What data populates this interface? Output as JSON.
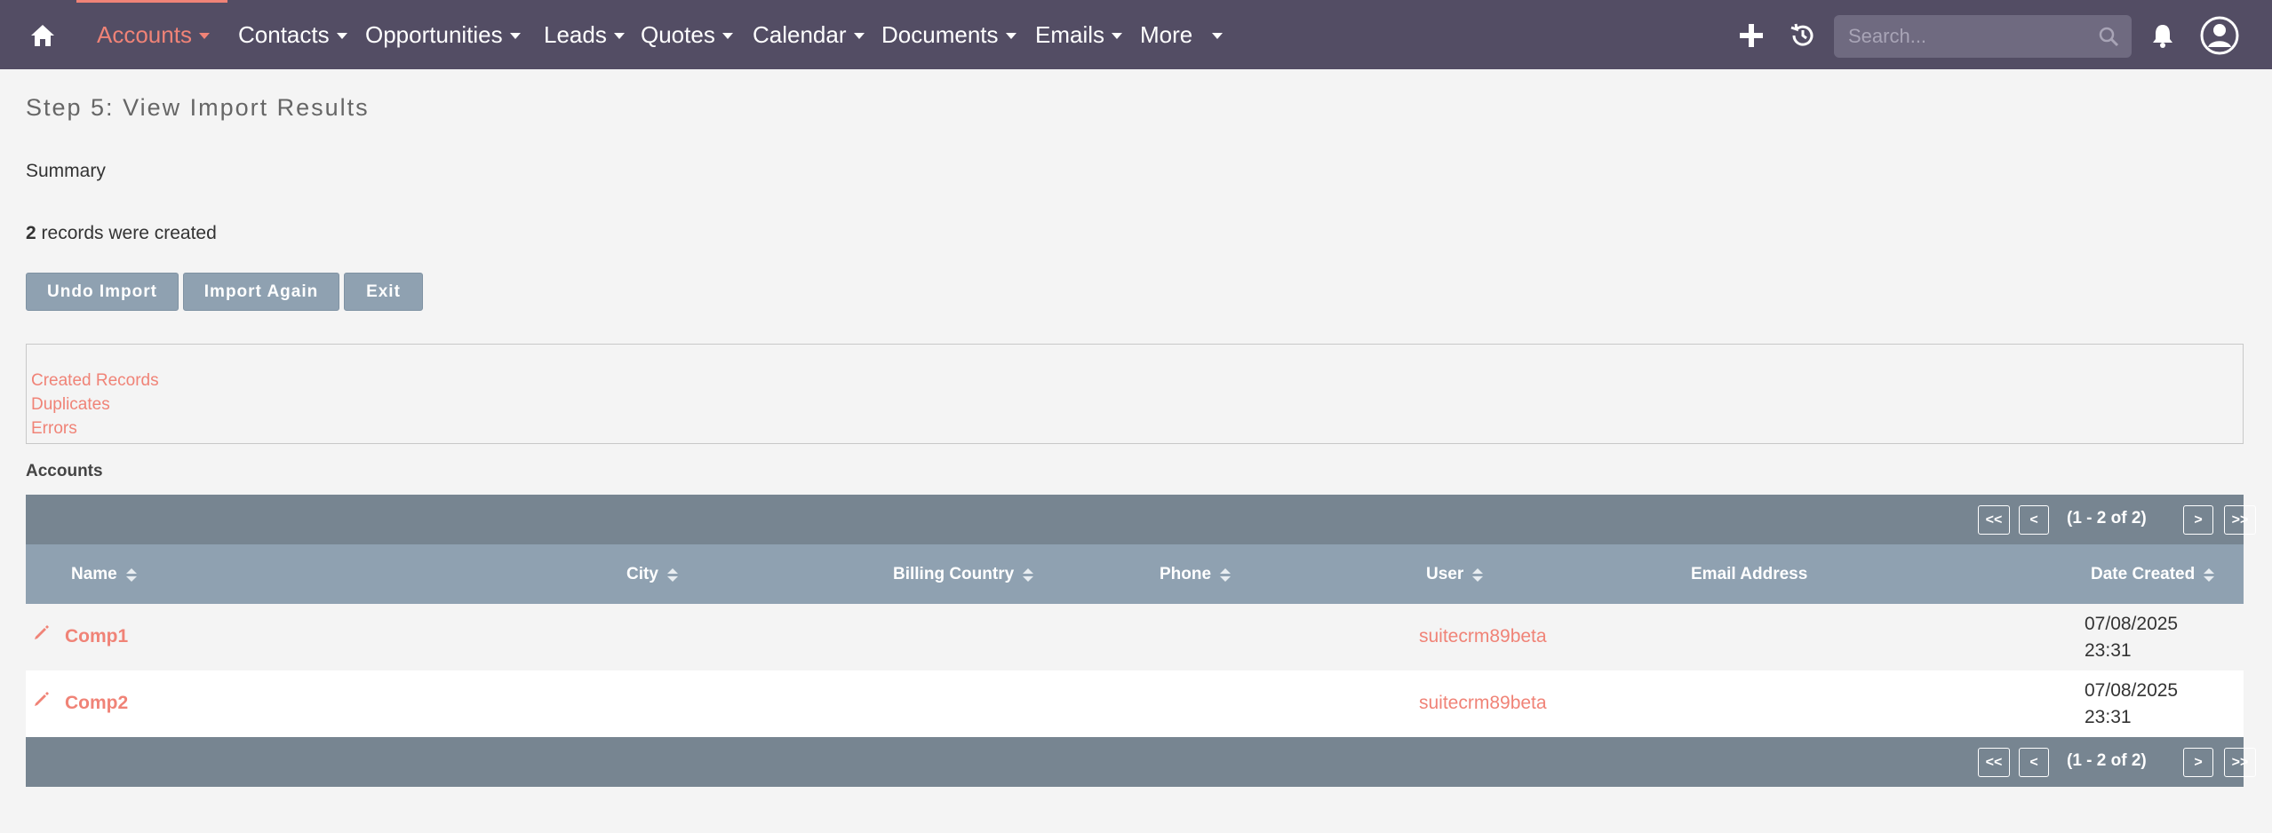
{
  "nav": {
    "items": [
      {
        "label": "Accounts",
        "active": true
      },
      {
        "label": "Contacts"
      },
      {
        "label": "Opportunities"
      },
      {
        "label": "Leads"
      },
      {
        "label": "Quotes"
      },
      {
        "label": "Calendar"
      },
      {
        "label": "Documents"
      },
      {
        "label": "Emails"
      },
      {
        "label": "More"
      }
    ],
    "search_placeholder": "Search...",
    "colors": {
      "bar": "#534d64",
      "accent": "#f08377"
    },
    "icons": [
      "home-icon",
      "plus-icon",
      "history-icon",
      "search-icon",
      "bell-icon",
      "user-avatar-icon"
    ]
  },
  "page": {
    "title": "Step 5: View Import Results",
    "summary_label": "Summary",
    "records_count": "2",
    "records_text": " records were created"
  },
  "buttons": {
    "undo": "Undo Import",
    "again": "Import Again",
    "exit": "Exit"
  },
  "results_tabs": [
    "Created Records",
    "Duplicates",
    "Errors"
  ],
  "table": {
    "module_label": "Accounts",
    "pagination": {
      "first": "<<",
      "prev": "<",
      "text": "(1 - 2 of 2)",
      "next": ">",
      "last": ">>"
    },
    "columns": [
      "Name",
      "City",
      "Billing Country",
      "Phone",
      "User",
      "Email Address",
      "Date Created"
    ],
    "rows": [
      {
        "name": "Comp1",
        "city": "",
        "billing_country": "",
        "phone": "",
        "user": "suitecrm89beta",
        "email": "",
        "date": "07/08/2025",
        "time": "23:31"
      },
      {
        "name": "Comp2",
        "city": "",
        "billing_country": "",
        "phone": "",
        "user": "suitecrm89beta",
        "email": "",
        "date": "07/08/2025",
        "time": "23:31"
      }
    ]
  }
}
